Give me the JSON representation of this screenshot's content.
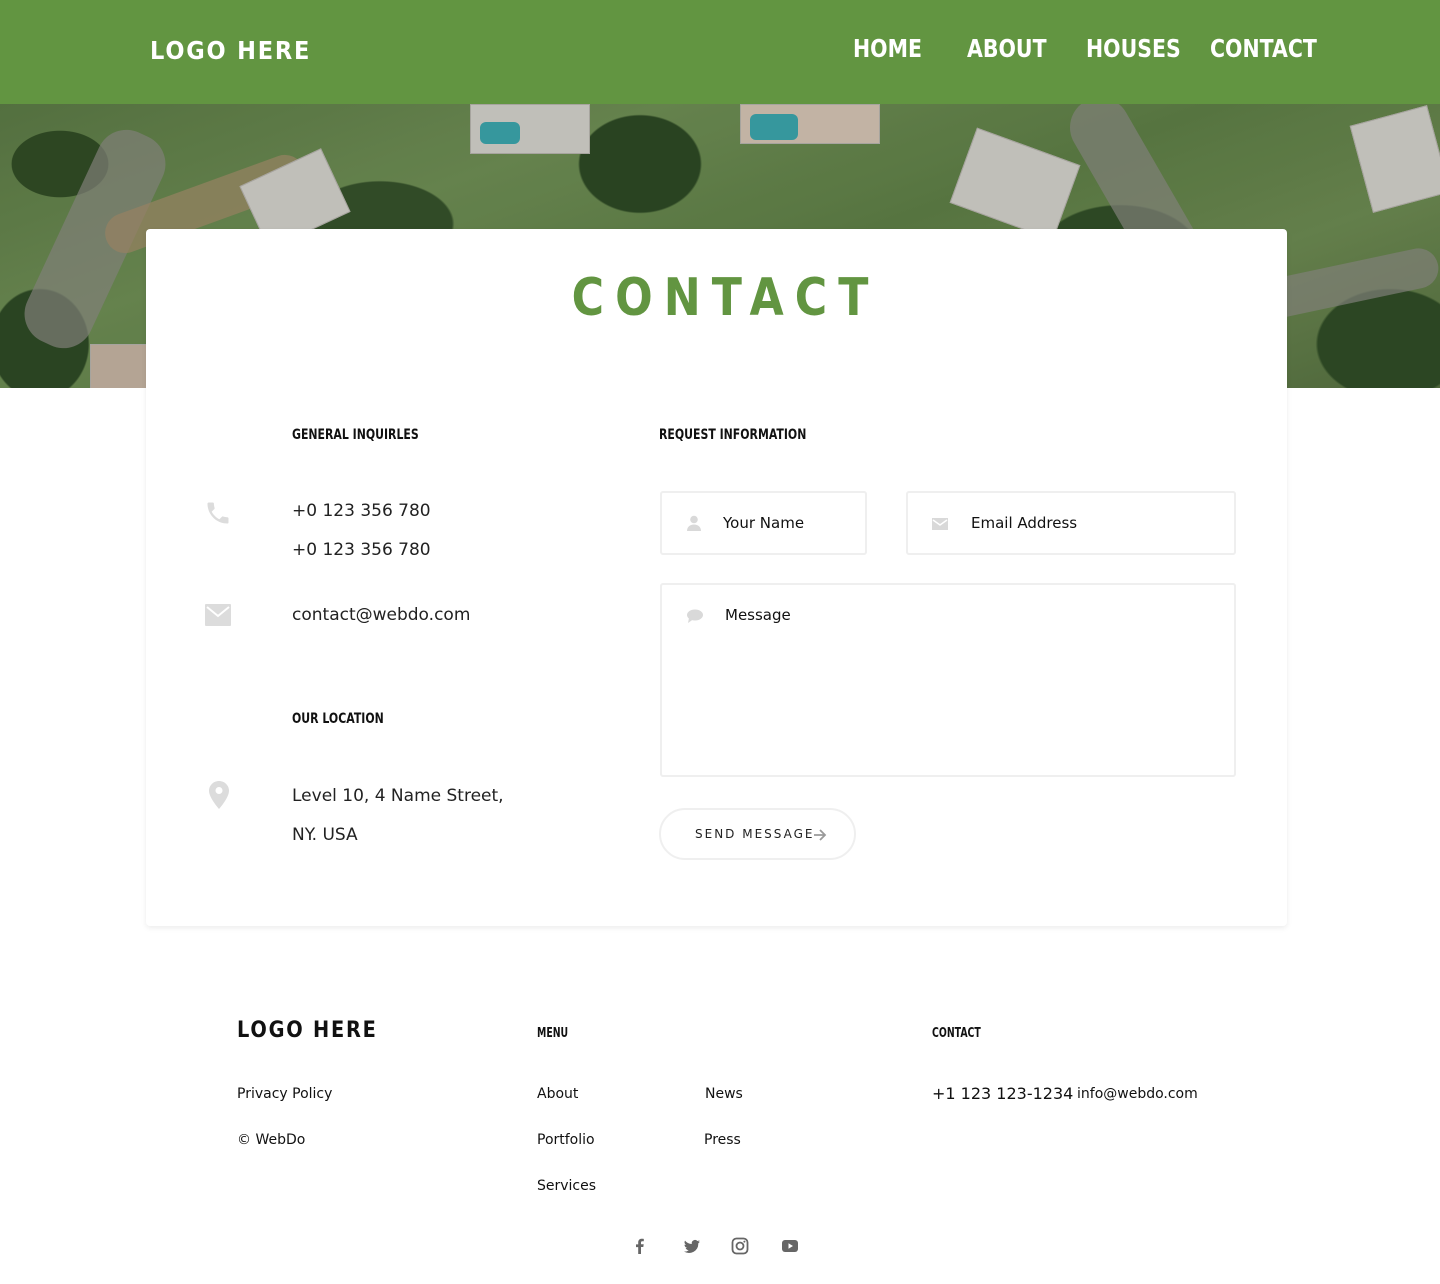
{
  "header": {
    "logo": "LOGO HERE",
    "nav": [
      {
        "label": "HOME"
      },
      {
        "label": "ABOUT"
      },
      {
        "label": "HOUSES"
      },
      {
        "label": "CONTACT"
      }
    ],
    "bg_color": "#629541"
  },
  "hero": {
    "image": "aerial-houses-photo"
  },
  "contact": {
    "title": "CONTACT",
    "general": {
      "heading": "GENERAL INQUIRLES",
      "phone_icon": "phone-icon",
      "phone_1": "+0 123 356 780",
      "phone_2": "+0 123 356 780",
      "mail_icon": "envelope-icon",
      "email": "contact@webdo.com"
    },
    "location": {
      "heading": "OUR LOCATION",
      "pin_icon": "map-pin-icon",
      "line_1": "Level 10, 4 Name Street,",
      "line_2": "NY. USA"
    },
    "form": {
      "heading": "REQUEST INFORMATION",
      "name_placeholder": "Your Name",
      "email_placeholder": "Email Address",
      "message_placeholder": "Message",
      "send_label": "SEND MESSAGE",
      "icons": [
        "user-icon",
        "envelope-icon",
        "chat-bubble-icon",
        "arrow-right-icon"
      ]
    }
  },
  "footer": {
    "logo": "LOGO HERE",
    "privacy": "Privacy Policy",
    "copyright": "© WebDo",
    "menu_heading": "MENU",
    "menu_col1": [
      "About",
      "Portfolio",
      "Services"
    ],
    "menu_col2": [
      "News",
      "Press"
    ],
    "contact_heading": "CONTACT",
    "phone": "+1 123 123-1234",
    "email": "info@webdo.com",
    "social": [
      "facebook-icon",
      "twitter-icon",
      "instagram-icon",
      "youtube-icon"
    ]
  },
  "colors": {
    "accent": "#629541",
    "icon_gray": "#d9d9d9",
    "border": "#efefef"
  }
}
